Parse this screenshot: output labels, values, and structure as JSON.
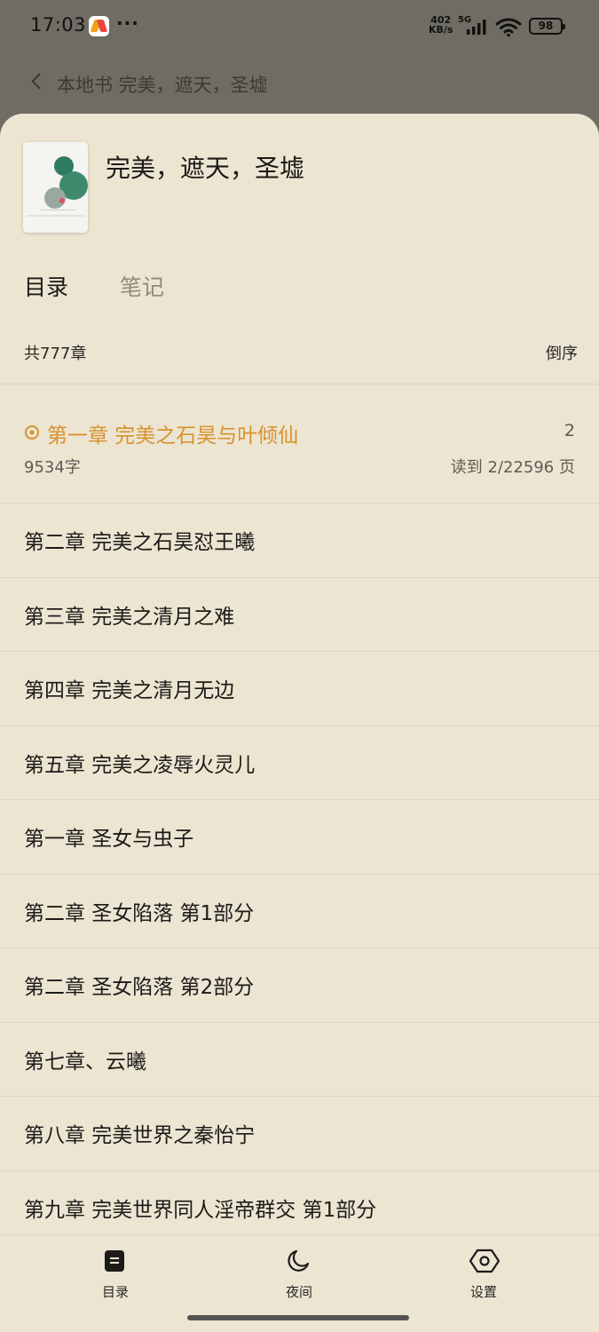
{
  "status_bar": {
    "time": "17:03",
    "dots": "···",
    "net_speed_value": "402",
    "net_speed_unit": "KB/s",
    "network": "5G",
    "battery": "98"
  },
  "background_header": {
    "title": "本地书 完美，遮天，圣墟"
  },
  "book": {
    "title": "完美，遮天，圣墟"
  },
  "tabs": [
    {
      "label": "目录",
      "active": true
    },
    {
      "label": "笔记",
      "active": false
    }
  ],
  "toc": {
    "chapter_count": "共777章",
    "sort_label": "倒序",
    "current": {
      "title": "第一章 完美之石昊与叶倾仙",
      "page": "2",
      "words": "9534字",
      "progress": "读到 2/22596 页"
    },
    "chapters": [
      "第二章 完美之石昊怼王曦",
      "第三章 完美之清月之难",
      "第四章 完美之清月无边",
      "第五章 完美之凌辱火灵儿",
      "第一章 圣女与虫子",
      "第二章 圣女陷落 第1部分",
      "第二章 圣女陷落 第2部分",
      "第七章、云曦",
      "第八章 完美世界之秦怡宁",
      "第九章 完美世界同人淫帝群交 第1部分"
    ]
  },
  "bottom_nav": [
    {
      "label": "目录",
      "icon": "toc-icon"
    },
    {
      "label": "夜间",
      "icon": "moon-icon"
    },
    {
      "label": "设置",
      "icon": "settings-icon"
    }
  ],
  "colors": {
    "accent": "#d8922e",
    "sheet_bg": "#ece5d2",
    "dim_bg": "#6e6c63"
  }
}
